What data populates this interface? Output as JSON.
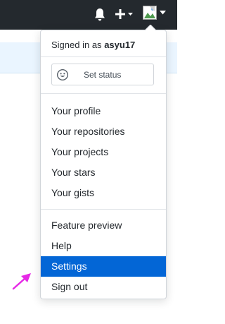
{
  "header": {
    "icons": [
      "bell-icon",
      "plus-icon",
      "avatar-image"
    ]
  },
  "dropdown": {
    "signed_in_prefix": "Signed in as",
    "username": "asyu17",
    "status_button_label": "Set status",
    "section1": [
      "Your profile",
      "Your repositories",
      "Your projects",
      "Your stars",
      "Your gists"
    ],
    "section2": [
      "Feature preview",
      "Help",
      "Settings",
      "Sign out"
    ],
    "active_item": "Settings"
  },
  "colors": {
    "header_bg": "#24292e",
    "active_bg": "#0366d6",
    "annotation_arrow": "#e629e6"
  }
}
